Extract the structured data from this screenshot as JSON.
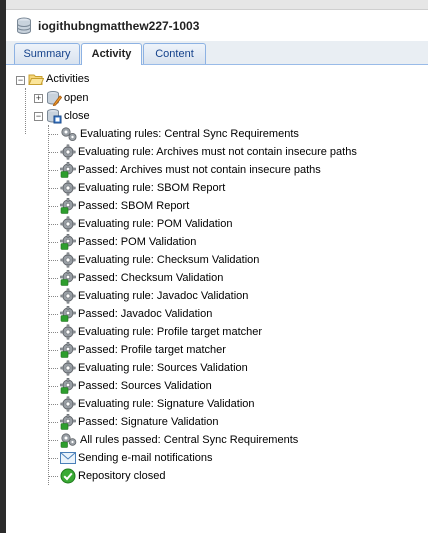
{
  "header": {
    "title": "iogithubngmatthew227-1003",
    "icon": "database-icon"
  },
  "tabs": [
    {
      "label": "Summary",
      "active": false
    },
    {
      "label": "Activity",
      "active": true
    },
    {
      "label": "Content",
      "active": false
    }
  ],
  "tree": {
    "root_label": "Activities",
    "open_label": "open",
    "close_label": "close",
    "events": [
      {
        "label": "Evaluating rules: Central Sync Requirements",
        "icon": "gears-icon"
      },
      {
        "label": "Evaluating rule: Archives must not contain insecure paths",
        "icon": "gear-icon"
      },
      {
        "label": "Passed: Archives must not contain insecure paths",
        "icon": "gear-passed-icon"
      },
      {
        "label": "Evaluating rule: SBOM Report",
        "icon": "gear-icon"
      },
      {
        "label": "Passed: SBOM Report",
        "icon": "gear-passed-icon"
      },
      {
        "label": "Evaluating rule: POM Validation",
        "icon": "gear-icon"
      },
      {
        "label": "Passed: POM Validation",
        "icon": "gear-passed-icon"
      },
      {
        "label": "Evaluating rule: Checksum Validation",
        "icon": "gear-icon"
      },
      {
        "label": "Passed: Checksum Validation",
        "icon": "gear-passed-icon"
      },
      {
        "label": "Evaluating rule: Javadoc Validation",
        "icon": "gear-icon"
      },
      {
        "label": "Passed: Javadoc Validation",
        "icon": "gear-passed-icon"
      },
      {
        "label": "Evaluating rule: Profile target matcher",
        "icon": "gear-icon"
      },
      {
        "label": "Passed: Profile target matcher",
        "icon": "gear-passed-icon"
      },
      {
        "label": "Evaluating rule: Sources Validation",
        "icon": "gear-icon"
      },
      {
        "label": "Passed: Sources Validation",
        "icon": "gear-passed-icon"
      },
      {
        "label": "Evaluating rule: Signature Validation",
        "icon": "gear-icon"
      },
      {
        "label": "Passed: Signature Validation",
        "icon": "gear-passed-icon"
      },
      {
        "label": "All rules passed: Central Sync Requirements",
        "icon": "gears-passed-icon"
      },
      {
        "label": "Sending e-mail notifications",
        "icon": "email-icon"
      },
      {
        "label": "Repository closed",
        "icon": "check-circle-icon"
      }
    ]
  }
}
